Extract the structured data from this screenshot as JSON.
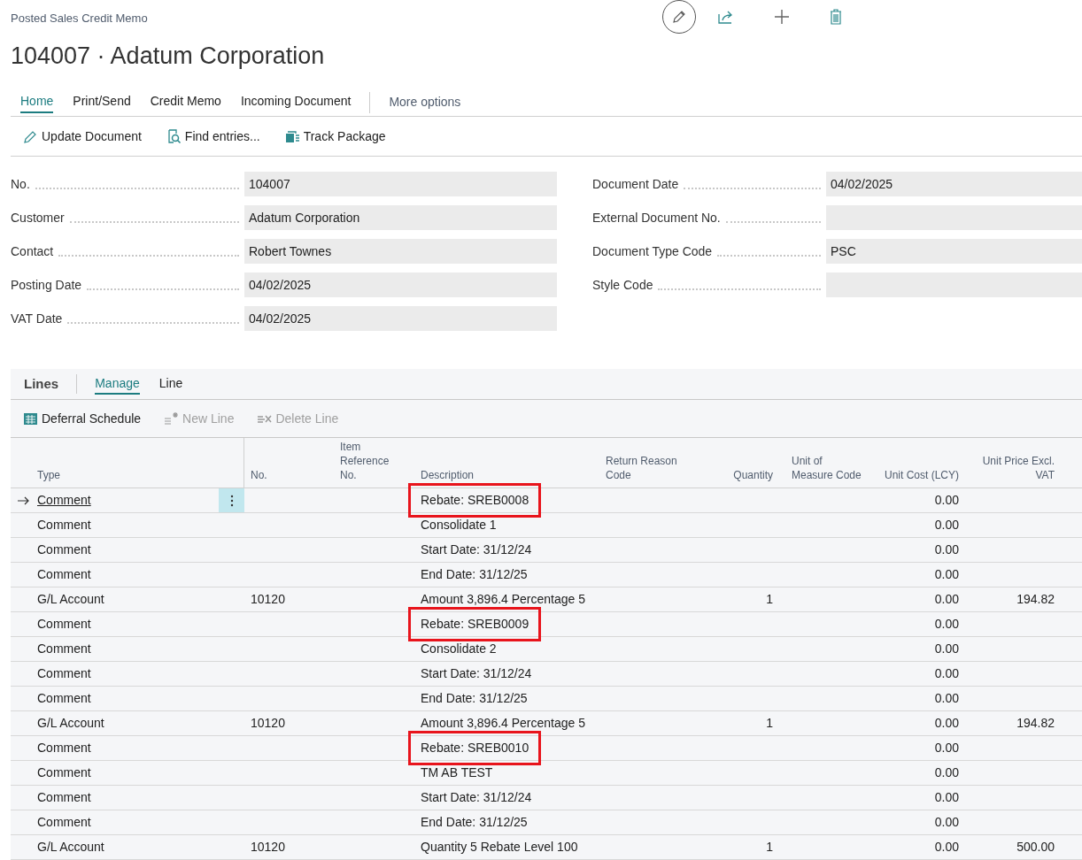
{
  "breadcrumb": "Posted Sales Credit Memo",
  "title": "104007 · Adatum Corporation",
  "action_tabs": [
    {
      "label": "Home",
      "selected": true
    },
    {
      "label": "Print/Send",
      "selected": false
    },
    {
      "label": "Credit Memo",
      "selected": false
    },
    {
      "label": "Incoming Document",
      "selected": false
    }
  ],
  "more_options": "More options",
  "actions": [
    {
      "label": "Update Document",
      "kind": "pencil"
    },
    {
      "label": "Find entries...",
      "kind": "find"
    },
    {
      "label": "Track Package",
      "kind": "truck"
    }
  ],
  "fields_left": [
    {
      "label": "No.",
      "value": "104007"
    },
    {
      "label": "Customer",
      "value": "Adatum Corporation"
    },
    {
      "label": "Contact",
      "value": "Robert Townes"
    },
    {
      "label": "Posting Date",
      "value": "04/02/2025"
    },
    {
      "label": "VAT Date",
      "value": "04/02/2025"
    }
  ],
  "fields_right": [
    {
      "label": "Document Date",
      "value": "04/02/2025"
    },
    {
      "label": "External Document No."
    },
    {
      "label": "Document Type Code",
      "value": "PSC"
    },
    {
      "label": "Style Code"
    }
  ],
  "lines": {
    "title": "Lines",
    "tabs": [
      {
        "label": "Manage",
        "selected": true
      },
      {
        "label": "Line",
        "selected": false
      }
    ],
    "actions": [
      {
        "label": "Deferral Schedule",
        "kind": "schedule",
        "disabled": false
      },
      {
        "label": "New Line",
        "kind": "new",
        "disabled": true
      },
      {
        "label": "Delete Line",
        "kind": "delete",
        "disabled": true
      }
    ],
    "columns": [
      "Type",
      "No.",
      "Item Reference No.",
      "Description",
      "Return Reason Code",
      "Quantity",
      "Unit of Measure Code",
      "Unit Cost (LCY)",
      "Unit Price Excl. VAT"
    ],
    "rows": [
      {
        "type": "Comment",
        "description": "Rebate: SREB0008",
        "unit_cost": "0.00",
        "selected": true,
        "highlighted": true
      },
      {
        "type": "Comment",
        "description": "Consolidate 1",
        "unit_cost": "0.00",
        "selected": false,
        "highlighted": false
      },
      {
        "type": "Comment",
        "description": "Start Date: 31/12/24",
        "unit_cost": "0.00",
        "selected": false,
        "highlighted": false
      },
      {
        "type": "Comment",
        "description": "End Date: 31/12/25",
        "unit_cost": "0.00",
        "selected": false,
        "highlighted": false
      },
      {
        "type": "G/L Account",
        "no": "10120",
        "description": "Amount 3,896.4 Percentage 5",
        "quantity": "1",
        "unit_cost": "0.00",
        "unit_price": "194.82",
        "selected": false,
        "highlighted": false
      },
      {
        "type": "Comment",
        "description": "Rebate: SREB0009",
        "unit_cost": "0.00",
        "selected": false,
        "highlighted": true
      },
      {
        "type": "Comment",
        "description": "Consolidate 2",
        "unit_cost": "0.00",
        "selected": false,
        "highlighted": false
      },
      {
        "type": "Comment",
        "description": "Start Date: 31/12/24",
        "unit_cost": "0.00",
        "selected": false,
        "highlighted": false
      },
      {
        "type": "Comment",
        "description": "End Date: 31/12/25",
        "unit_cost": "0.00",
        "selected": false,
        "highlighted": false
      },
      {
        "type": "G/L Account",
        "no": "10120",
        "description": "Amount 3,896.4 Percentage 5",
        "quantity": "1",
        "unit_cost": "0.00",
        "unit_price": "194.82",
        "selected": false,
        "highlighted": false
      },
      {
        "type": "Comment",
        "description": "Rebate: SREB0010",
        "unit_cost": "0.00",
        "selected": false,
        "highlighted": true
      },
      {
        "type": "Comment",
        "description": "TM AB TEST",
        "unit_cost": "0.00",
        "selected": false,
        "highlighted": false
      },
      {
        "type": "Comment",
        "description": "Start Date: 31/12/24",
        "unit_cost": "0.00",
        "selected": false,
        "highlighted": false
      },
      {
        "type": "Comment",
        "description": "End Date: 31/12/25",
        "unit_cost": "0.00",
        "selected": false,
        "highlighted": false
      },
      {
        "type": "G/L Account",
        "no": "10120",
        "description": "Quantity 5 Rebate Level 100",
        "quantity": "1",
        "unit_cost": "0.00",
        "unit_price": "500.00",
        "selected": false,
        "highlighted": false
      }
    ]
  }
}
